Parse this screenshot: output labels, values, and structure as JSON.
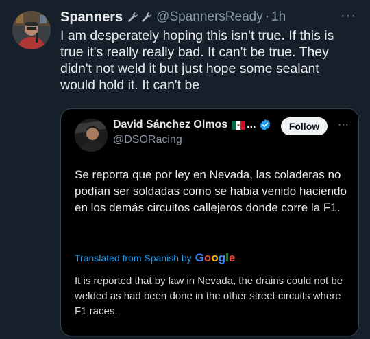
{
  "tweet": {
    "author_name": "Spanners",
    "handle": "@SpannersReady",
    "separator": "·",
    "time": "1h",
    "body": "I am desperately hoping this isn't true. If this is true it's really really bad. It can't be true. They didn't not weld it but just hope some sealant would hold it. It can't be",
    "more_icon": "more-horizontal-icon"
  },
  "quoted": {
    "author_name": "David Sánchez Olmos",
    "truncation": "...",
    "handle": "@DSORacing",
    "follow_label": "Follow",
    "text": "Se reporta que por ley en Nevada, las coladeras no podían ser soldadas como se habia venido haciendo en los demás circuitos callejeros donde corre la F1.",
    "translated_label": "Translated from Spanish by",
    "translated_provider": "Google",
    "translation": "It is reported that by law in Nevada, the drains could not be welded as had been done in the other street circuits where F1 races.",
    "verified_color": "#1d9bf0"
  },
  "colors": {
    "background": "#15202b",
    "text": "#e7e9ea",
    "muted": "#8b98a5",
    "link": "#1d9bf0"
  }
}
